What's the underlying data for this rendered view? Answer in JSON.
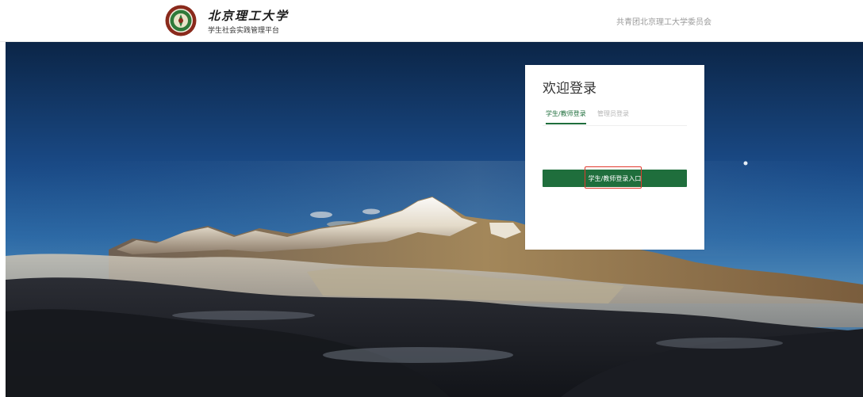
{
  "header": {
    "brand_title": "北京理工大学",
    "brand_subtitle": "学生社会实践管理平台",
    "org_link": "共青团北京理工大学委员会",
    "logo_icon": "university-seal-icon"
  },
  "hero": {
    "image": "snow-mountain-landscape"
  },
  "login": {
    "title": "欢迎登录",
    "tabs": [
      {
        "label": "学生/教师登录",
        "active": true
      },
      {
        "label": "管理员登录",
        "active": false
      }
    ],
    "button_label": "学生/教师登录入口"
  },
  "colors": {
    "accent": "#1f6e3c",
    "highlight": "#e23a2e"
  }
}
